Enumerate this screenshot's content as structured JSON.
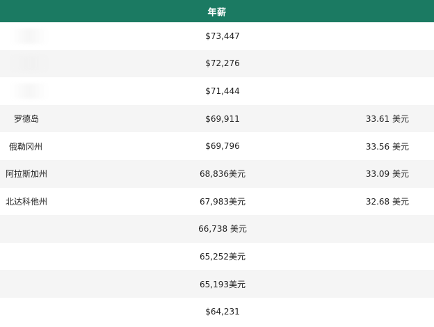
{
  "table": {
    "header": {
      "annual_salary": "年薪"
    },
    "rows": [
      {
        "state": "",
        "annual": "$73,447",
        "hourly": ""
      },
      {
        "state": "",
        "annual": "$72,276",
        "hourly": ""
      },
      {
        "state": "",
        "annual": "$71,444",
        "hourly": ""
      },
      {
        "state": "罗德岛",
        "annual": "$69,911",
        "hourly": "33.61 美元"
      },
      {
        "state": "俄勒冈州",
        "annual": "$69,796",
        "hourly": "33.56 美元"
      },
      {
        "state": "阿拉斯加州",
        "annual": "68,836美元",
        "hourly": "33.09 美元"
      },
      {
        "state": "北达科他州",
        "annual": "67,983美元",
        "hourly": "32.68 美元"
      },
      {
        "state": "",
        "annual": "66,738 美元",
        "hourly": ""
      },
      {
        "state": "",
        "annual": "65,252美元",
        "hourly": ""
      },
      {
        "state": "",
        "annual": "65,193美元",
        "hourly": ""
      },
      {
        "state": "",
        "annual": "$64,231",
        "hourly": ""
      }
    ]
  },
  "colors": {
    "header_bg": "#1b7a62",
    "row_alt_bg": "#f5f5f5",
    "row_bg": "#ffffff"
  }
}
